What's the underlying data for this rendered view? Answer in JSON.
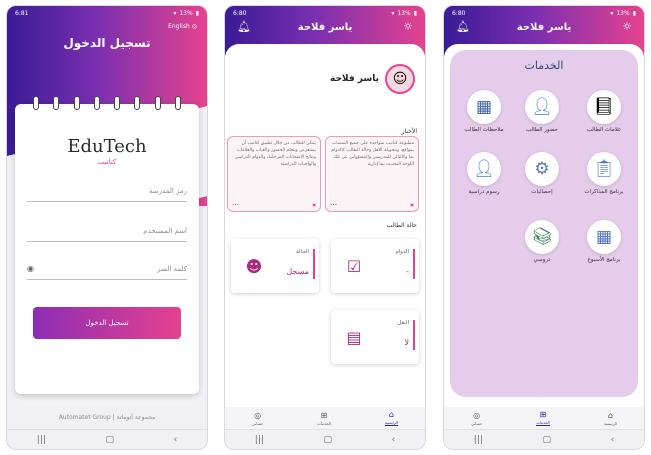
{
  "screen1": {
    "status": {
      "time": "6:81",
      "battery": "13%"
    },
    "lang_label": "English",
    "title": "تسجيل الدخول",
    "logo": "EduTech",
    "logo_sub": "كتاتيب",
    "fields": {
      "school": "رمز المدرسة",
      "username": "اسم المستخدم",
      "password": "كلمة السر"
    },
    "login_button": "تسجيل الدخول",
    "footer": "Automatet Group | مجموعة أتوماتة"
  },
  "screen2": {
    "status": {
      "time": "6:80",
      "battery": "13%"
    },
    "header_title": "ياسر فلاحة",
    "profile_name": "ياسر فلاحة",
    "news_label": "الأخبار",
    "news": [
      "مطبوعة كتاتيب متواجدة على جميع المنصات بمواقع، وبتحويلة للأهل وحالة الطالب كالدوام بما وكالتالي للمدرسين والمسؤولين عن تلك اللوحة التحديث بما إدارية",
      "يمكن للطالب من خلال تطبيق كتاتيب أن يستعرض ويتعلم الحضور والغياب والعلامات ونتائج الامتحانات المرحلية، والدوام الدراسي والواجبات الدراسية"
    ],
    "status_label": "حالة الطالب",
    "cards": [
      {
        "title": "الدوام",
        "value": "-"
      },
      {
        "title": "الحالة",
        "value": "مسجل"
      },
      {
        "title": "النقل",
        "value": "لا"
      }
    ],
    "tabs": [
      "الرئيسية",
      "الخدمات",
      "حسابي"
    ]
  },
  "screen3": {
    "status": {
      "time": "6:80",
      "battery": "13%"
    },
    "header_title": "ياسر فلاحة",
    "panel_title": "الخدمات",
    "services": [
      "علامات الطالب",
      "حضور الطالب",
      "ملاحظات الطالب",
      "برنامج المذاكرات",
      "إحصائيات",
      "رسوم دراسية",
      "برنامج الأسبوع",
      "دروسي"
    ],
    "tabs": [
      "الرئيسية",
      "الخدمات",
      "حسابي"
    ]
  }
}
